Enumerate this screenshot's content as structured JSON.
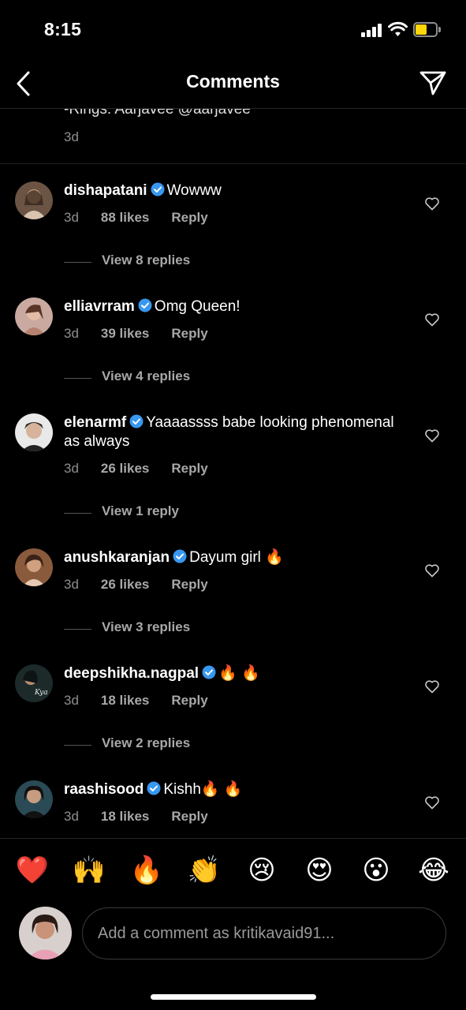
{
  "status_bar": {
    "time": "8:15"
  },
  "header": {
    "title": "Comments"
  },
  "caption": {
    "text": "-Rings: Aarjavee @aarjavee",
    "time": "3d"
  },
  "comments": [
    {
      "username": "dishapatani",
      "text": "Wowww",
      "time": "3d",
      "likes": "88 likes",
      "reply": "Reply",
      "view_replies": "View 8 replies"
    },
    {
      "username": "elliavrram",
      "text": "Omg Queen!",
      "time": "3d",
      "likes": "39 likes",
      "reply": "Reply",
      "view_replies": "View 4 replies"
    },
    {
      "username": "elenarmf",
      "text": "Yaaaassss babe looking phenomenal as always",
      "time": "3d",
      "likes": "26 likes",
      "reply": "Reply",
      "view_replies": "View 1 reply"
    },
    {
      "username": "anushkaranjan",
      "text": "Dayum girl 🔥",
      "time": "3d",
      "likes": "26 likes",
      "reply": "Reply",
      "view_replies": "View 3 replies"
    },
    {
      "username": "deepshikha.nagpal",
      "text": "🔥 🔥",
      "time": "3d",
      "likes": "18 likes",
      "reply": "Reply",
      "view_replies": "View 2 replies"
    },
    {
      "username": "raashisood",
      "text": "Kishh🔥 🔥",
      "time": "3d",
      "likes": "18 likes",
      "reply": "Reply"
    }
  ],
  "emoji_bar": [
    "❤️",
    "🙌",
    "🔥",
    "👏",
    "😢",
    "😍",
    "😮",
    "😂"
  ],
  "composer": {
    "placeholder": "Add a comment as kritikavaid91..."
  },
  "colors": {
    "background": "#000000",
    "text": "#ffffff",
    "muted": "#8e8e8e",
    "verified": "#3897f0"
  },
  "icons": [
    "back-arrow-icon",
    "direct-send-icon",
    "verified-badge-icon",
    "heart-outline-icon"
  ]
}
